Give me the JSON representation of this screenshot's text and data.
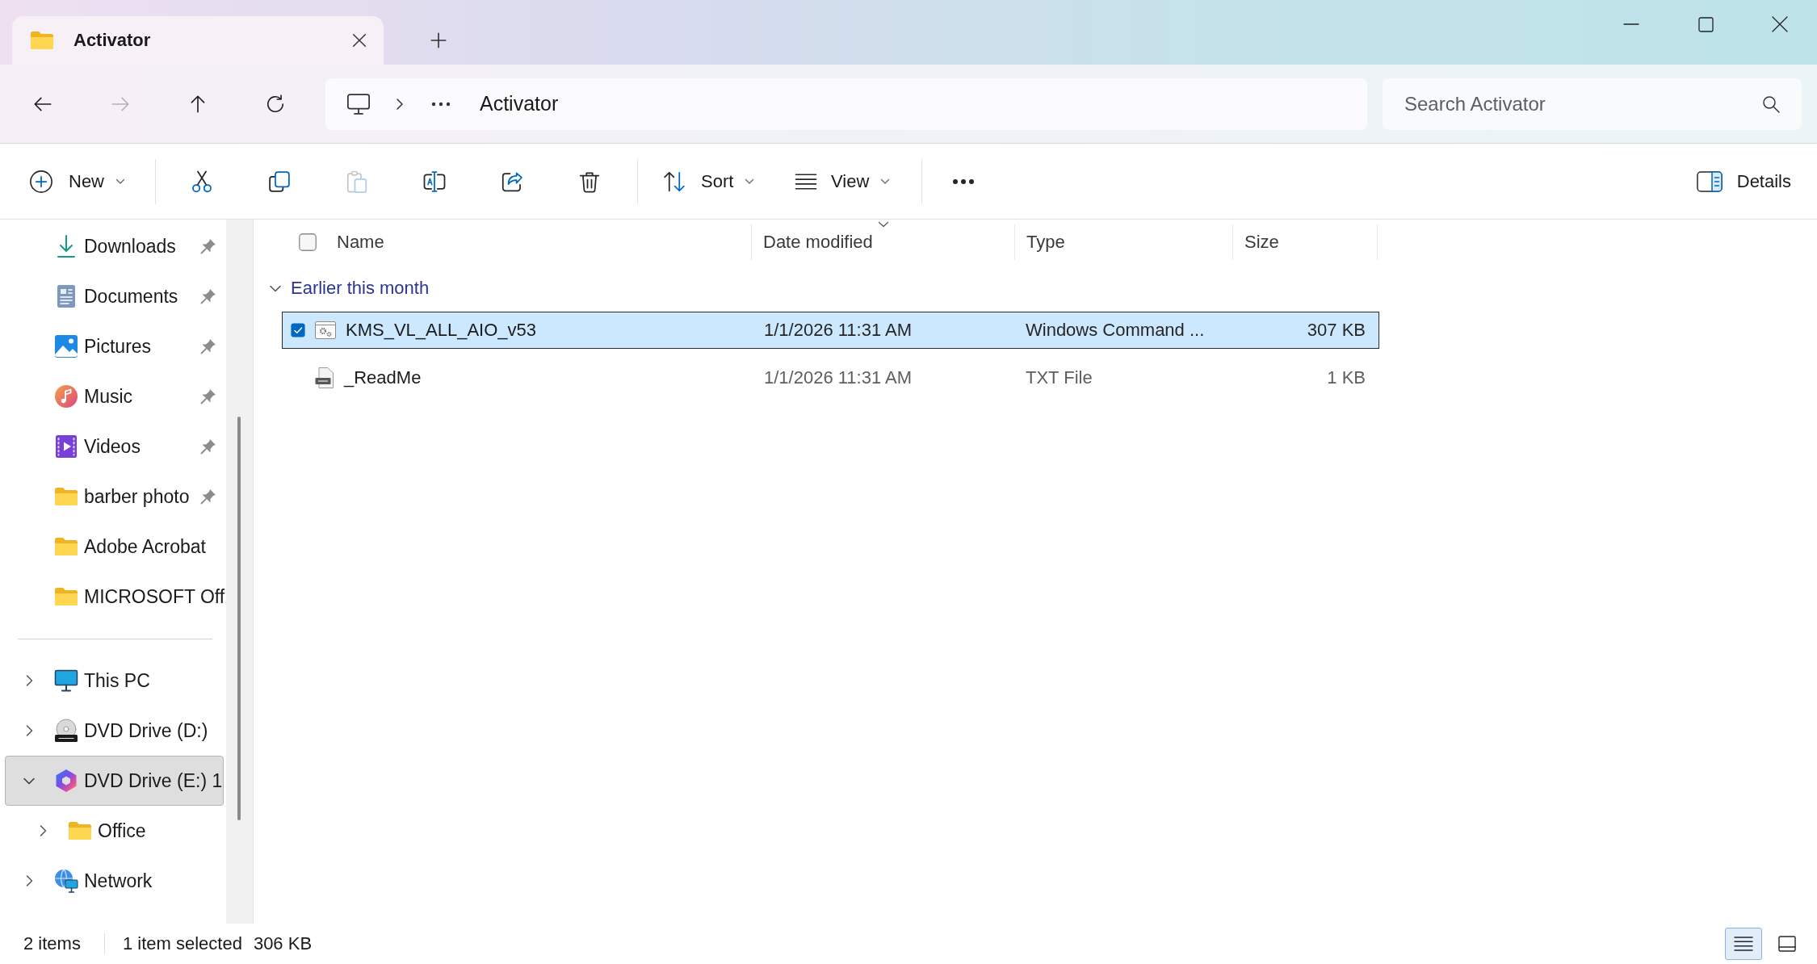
{
  "tabs": [
    {
      "label": "Activator",
      "selected": true
    }
  ],
  "nav_buttons": [
    {
      "kind": "back",
      "disabled": false
    },
    {
      "kind": "forward",
      "disabled": true
    },
    {
      "kind": "up",
      "disabled": false
    },
    {
      "kind": "refresh",
      "disabled": false
    }
  ],
  "address_bar": {
    "location": "Activator"
  },
  "search": {
    "placeholder": "Search Activator"
  },
  "toolbar": {
    "items": [
      {
        "kind": "new",
        "label": "New",
        "disabled": false
      },
      {
        "kind": "separator"
      },
      {
        "kind": "cut",
        "disabled": false
      },
      {
        "kind": "copy",
        "disabled": false
      },
      {
        "kind": "paste",
        "disabled": true
      },
      {
        "kind": "rename",
        "disabled": false
      },
      {
        "kind": "share",
        "disabled": false
      },
      {
        "kind": "delete",
        "disabled": false
      },
      {
        "kind": "separator"
      },
      {
        "kind": "sort",
        "label": "Sort",
        "disabled": false
      },
      {
        "kind": "view",
        "label": "View",
        "disabled": false
      },
      {
        "kind": "separator"
      },
      {
        "kind": "more",
        "disabled": false
      }
    ],
    "details": {
      "label": "Details"
    }
  },
  "sidebar": {
    "quick_access": [
      {
        "kind": "downloads",
        "label": "Downloads",
        "pinned": true,
        "selected": false
      },
      {
        "kind": "documents",
        "label": "Documents",
        "pinned": true,
        "selected": false
      },
      {
        "kind": "pictures",
        "label": "Pictures",
        "pinned": true,
        "selected": false
      },
      {
        "kind": "music",
        "label": "Music",
        "pinned": true,
        "selected": false
      },
      {
        "kind": "videos",
        "label": "Videos",
        "pinned": true,
        "selected": false
      },
      {
        "kind": "folder",
        "label": "barber photo",
        "pinned": true,
        "selected": false
      },
      {
        "kind": "folder",
        "label": "Adobe Acrobat",
        "pinned": false,
        "selected": false
      },
      {
        "kind": "folder",
        "label": "MICROSOFT Off",
        "pinned": false,
        "selected": false
      }
    ],
    "tree": [
      {
        "kind": "computer",
        "label": "This PC",
        "expanded": false,
        "selected": false
      },
      {
        "kind": "dvd",
        "label": "DVD Drive (D:)",
        "expanded": false,
        "selected": false
      },
      {
        "kind": "dvd-app",
        "label": "DVD Drive (E:) 1",
        "expanded": true,
        "selected": true,
        "children": [
          {
            "kind": "folder",
            "label": "Office",
            "expanded": false,
            "selected": false
          }
        ]
      },
      {
        "kind": "network",
        "label": "Network",
        "expanded": false,
        "selected": false
      }
    ]
  },
  "file_list": {
    "header_checkbox": {
      "checked": false
    },
    "columns": [
      {
        "label": "Name",
        "sorted": false
      },
      {
        "label": "Date modified",
        "sorted": true
      },
      {
        "label": "Type",
        "sorted": false
      },
      {
        "label": "Size",
        "sorted": false
      }
    ],
    "groups": [
      {
        "label": "Earlier this month",
        "expanded": true,
        "rows": [
          {
            "kind": "script",
            "name": "KMS_VL_ALL_AIO_v53",
            "date": "1/1/2026 11:31 AM",
            "type": "Windows Command ...",
            "size": "307 KB",
            "selected": true,
            "checked": true
          },
          {
            "kind": "text",
            "name": "_ReadMe",
            "date": "1/1/2026 11:31 AM",
            "type": "TXT File",
            "size": "1 KB",
            "selected": false,
            "checked": false
          }
        ]
      }
    ]
  },
  "status_bar": {
    "item_count": "2 items",
    "selection": "1 item selected",
    "selection_size": "306 KB",
    "views": [
      {
        "kind": "details",
        "selected": true
      },
      {
        "kind": "tiles",
        "selected": false
      }
    ]
  }
}
